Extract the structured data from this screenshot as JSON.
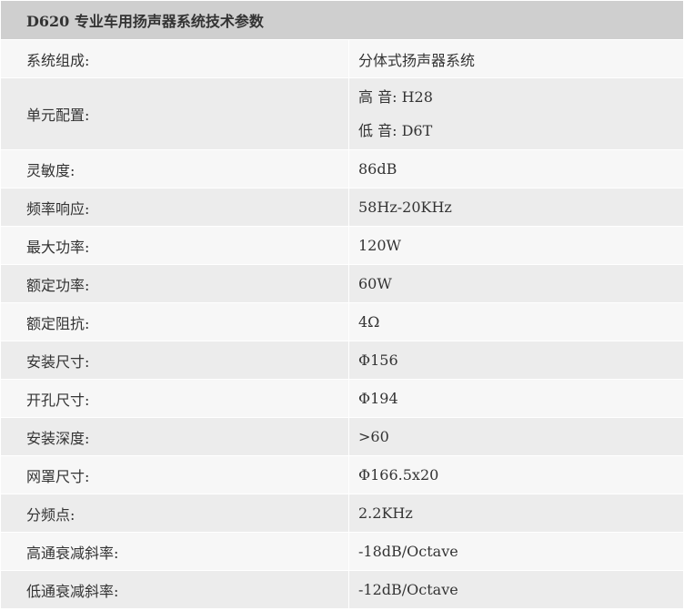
{
  "title": "D620 专业车用扬声器系统技术参数",
  "rows": [
    {
      "label": "系统组成:",
      "values": [
        "分体式扬声器系统"
      ]
    },
    {
      "label": "单元配置:",
      "values": [
        "高 音: H28",
        "低 音: D6T"
      ]
    },
    {
      "label": "灵敏度:",
      "values": [
        "86dB"
      ]
    },
    {
      "label": "频率响应:",
      "values": [
        "58Hz-20KHz"
      ]
    },
    {
      "label": "最大功率:",
      "values": [
        "120W"
      ]
    },
    {
      "label": "额定功率:",
      "values": [
        "60W"
      ]
    },
    {
      "label": "额定阻抗:",
      "values": [
        "4Ω"
      ]
    },
    {
      "label": "安装尺寸:",
      "values": [
        "Φ156"
      ]
    },
    {
      "label": "开孔尺寸:",
      "values": [
        "Φ194"
      ]
    },
    {
      "label": "安装深度:",
      "values": [
        ">60"
      ]
    },
    {
      "label": "网罩尺寸:",
      "values": [
        "Φ166.5x20"
      ]
    },
    {
      "label": "分频点:",
      "values": [
        "2.2KHz"
      ]
    },
    {
      "label": "高通衰减斜率:",
      "values": [
        "-18dB/Octave"
      ]
    },
    {
      "label": "低通衰减斜率:",
      "values": [
        "-12dB/Octave"
      ]
    }
  ]
}
